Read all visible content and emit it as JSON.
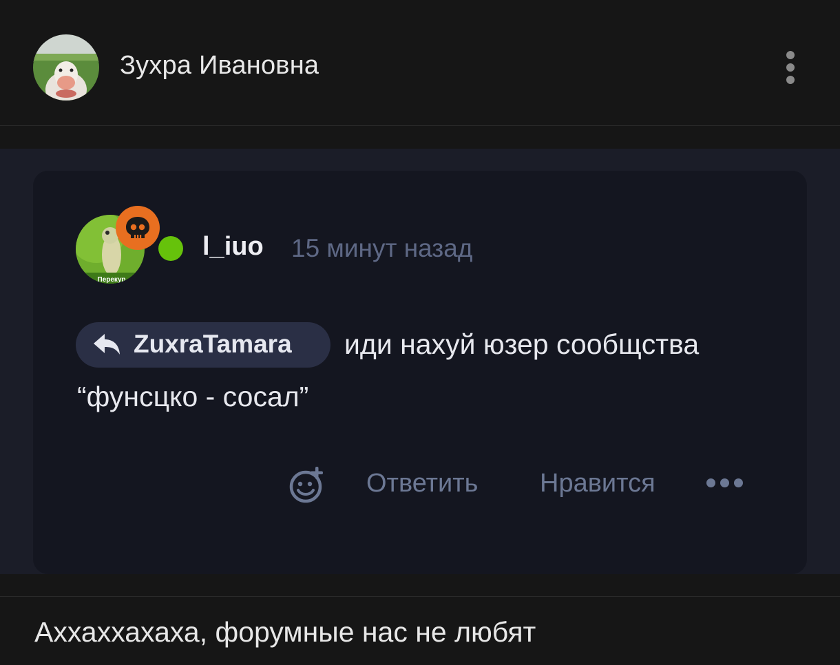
{
  "header": {
    "author_name": "Зухра Ивановна",
    "more_icon": "kebab-vertical-icon"
  },
  "quote": {
    "username": "l_iuo",
    "timestamp": "15 минут назад",
    "badge_icon": "skull-icon",
    "status": "online",
    "avatar_caption": "Перекур",
    "reply_to": "ZuxraTamara",
    "reply_icon": "reply-arrow-icon",
    "text_line1": "иди нахуй юзер сообщства",
    "text_line2": "“фунсцко - сосал”",
    "actions": {
      "emoji_icon": "add-reaction-icon",
      "reply_label": "Ответить",
      "like_label": "Нравится",
      "more_icon": "more-dots-icon"
    }
  },
  "message": {
    "text": "Аххаххахаха, форумные нас не любят"
  },
  "colors": {
    "background": "#161616",
    "card": "#141620",
    "panel": "#1b1d28",
    "badge_orange": "#e86f20",
    "online_green": "#66c20b",
    "muted": "#6c7894",
    "chip": "#2a2f45"
  }
}
